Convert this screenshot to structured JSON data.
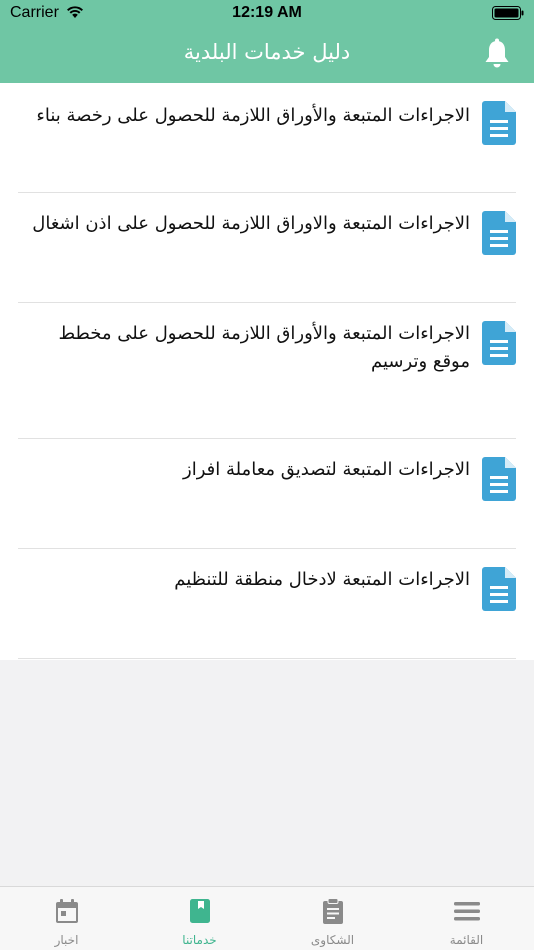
{
  "status_bar": {
    "carrier": "Carrier",
    "time": "12:19 AM"
  },
  "header": {
    "title": "دليل خدمات البلدية",
    "bell_icon": "bell-icon"
  },
  "list": {
    "items": [
      {
        "text": "الاجراءات المتبعة والأوراق اللازمة للحصول على رخصة بناء",
        "icon": "document-icon"
      },
      {
        "text": "الاجراءات المتبعة والاوراق اللازمة للحصول على اذن اشغال",
        "icon": "document-icon"
      },
      {
        "text": "الاجراءات المتبعة والأوراق اللازمة  للحصول على مخطط موقع وترسيم",
        "icon": "document-icon"
      },
      {
        "text": "الاجراءات المتبعة لتصديق معاملة افراز",
        "icon": "document-icon"
      },
      {
        "text": "الاجراءات المتبعة لادخال منطقة للتنظيم",
        "icon": "document-icon"
      }
    ]
  },
  "tabbar": {
    "tabs": [
      {
        "label": "اخبار",
        "icon": "calendar-icon",
        "active": false
      },
      {
        "label": "خدماتنا",
        "icon": "book-icon",
        "active": true
      },
      {
        "label": "الشكاوى",
        "icon": "clipboard-icon",
        "active": false
      },
      {
        "label": "القائمة",
        "icon": "menu-icon",
        "active": false
      }
    ]
  },
  "colors": {
    "header": "#6fc6a4",
    "doc_icon": "#3fa4d6",
    "active_tab": "#3fb58f",
    "inactive_tab": "#8a8a8a"
  }
}
